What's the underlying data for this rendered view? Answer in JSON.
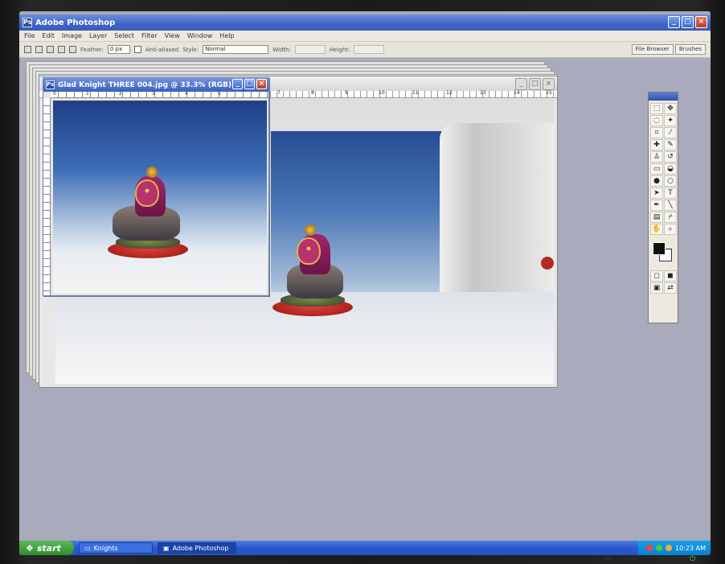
{
  "window": {
    "title": "Adobe Photoshop",
    "icon": "photoshop-icon",
    "buttons": [
      "minimize-icon",
      "maximize-icon",
      "close-icon"
    ]
  },
  "menu": [
    "File",
    "Edit",
    "Image",
    "Layer",
    "Select",
    "Filter",
    "View",
    "Window",
    "Help"
  ],
  "options_bar": {
    "feather_label": "Feather:",
    "feather_value": "0 px",
    "anti_aliased_label": "Anti-aliased",
    "style_label": "Style:",
    "style_value": "Normal",
    "width_label": "Width:",
    "height_label": "Height:",
    "well_tabs": [
      "File Browser",
      "Brushes"
    ]
  },
  "document": {
    "title": "Glad Knight THREE 004.jpg @ 33.3% (RGB)",
    "ruler_marks": [
      "0",
      "1",
      "2",
      "3",
      "4",
      "5"
    ]
  },
  "back_document": {
    "ruler_marks": [
      "7",
      "8",
      "9",
      "10",
      "11",
      "12",
      "13",
      "14",
      "15"
    ]
  },
  "tools": {
    "icons": [
      "marquee-icon",
      "move-icon",
      "lasso-icon",
      "magic-wand-icon",
      "crop-icon",
      "slice-icon",
      "healing-brush-icon",
      "brush-icon",
      "clone-stamp-icon",
      "history-brush-icon",
      "eraser-icon",
      "paint-bucket-icon",
      "blur-icon",
      "dodge-icon",
      "path-selection-icon",
      "type-icon",
      "pen-icon",
      "line-icon",
      "notes-icon",
      "eyedropper-icon",
      "hand-icon",
      "zoom-icon"
    ],
    "foreground_color": "#111111",
    "background_color": "#ffffff"
  },
  "taskbar": {
    "start_label": "start",
    "tasks": [
      "Knights",
      "Adobe Photoshop"
    ],
    "clock": "10:23 AM"
  },
  "colors": {
    "xp_blue": "#2c57c9",
    "start_green": "#3a9b38",
    "close_red": "#c2391c",
    "backdrop_blue": "#3c6bb5"
  }
}
